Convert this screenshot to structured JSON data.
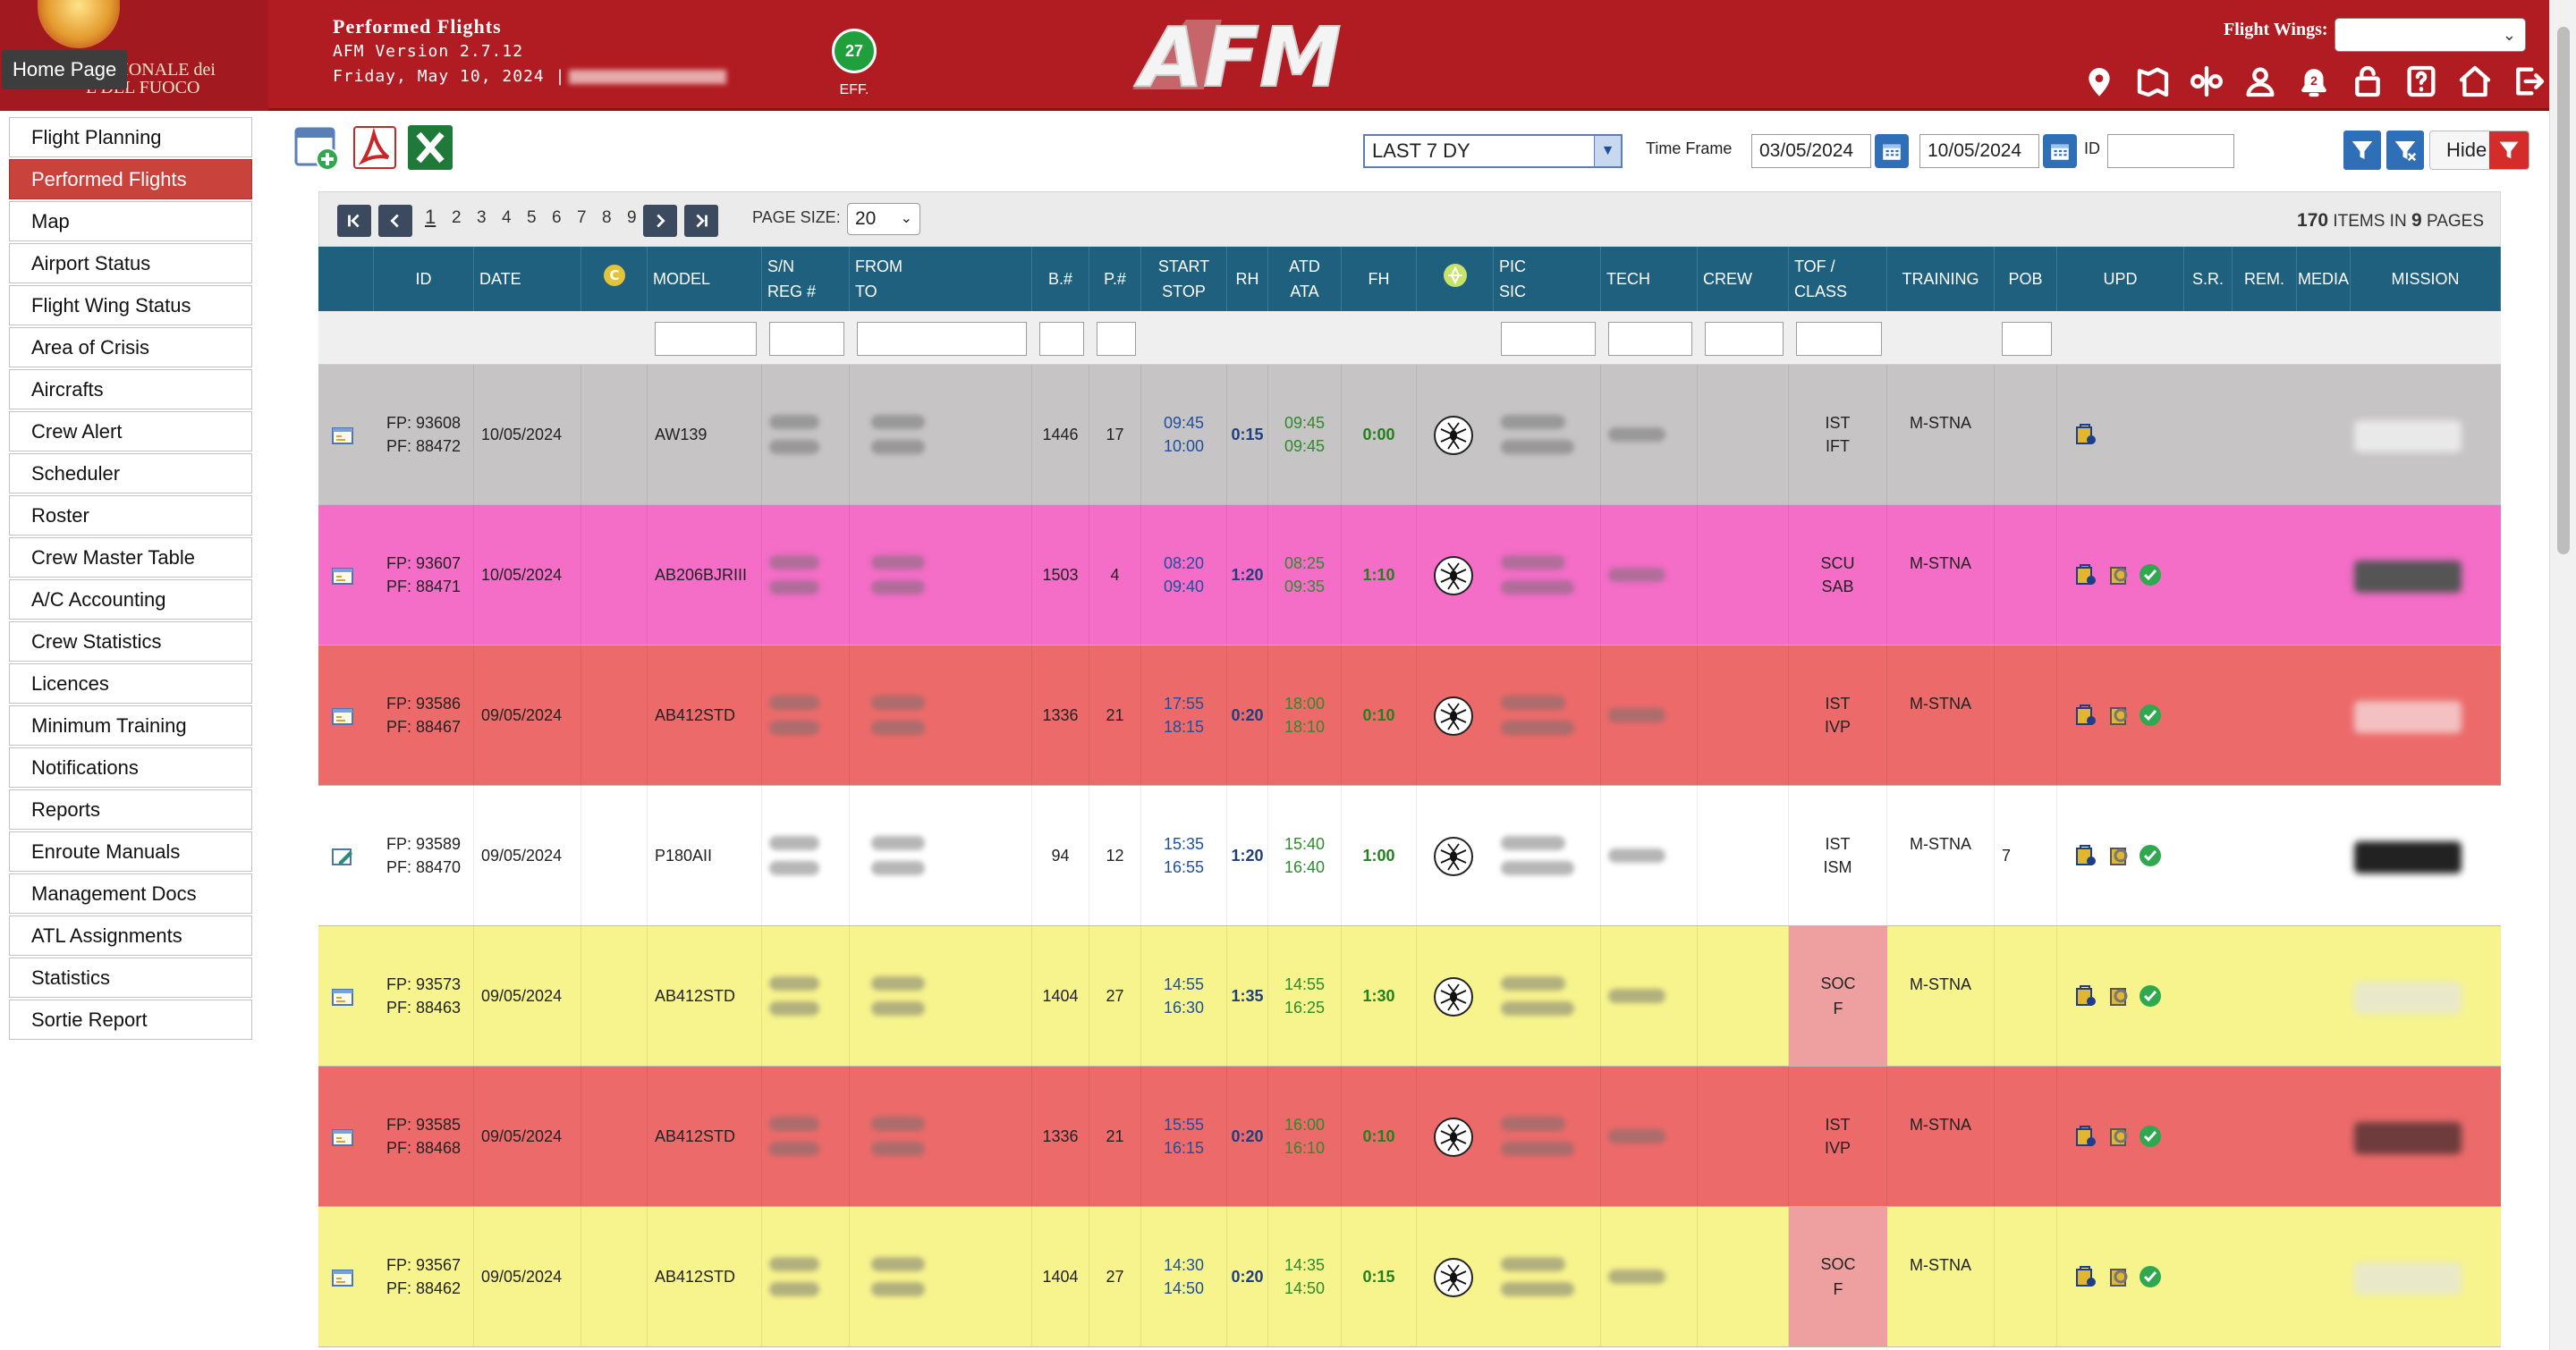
{
  "header": {
    "title": "Performed Flights",
    "version": "AFM Version 2.7.12",
    "date": "Friday, May 10, 2024 |",
    "logo_text": "NAZIONALE dei\nL DEL FUOCO",
    "home_tooltip": "Home Page",
    "eff_count": "27",
    "eff_label": "EFF.",
    "flight_wings_label": "Flight Wings:",
    "flight_wings_value": "",
    "notifications_count": "2",
    "colors": {
      "brand": "#b01c22",
      "active_nav": "#c9423c",
      "table_header": "#1f607f"
    }
  },
  "header_icons": [
    "location-icon",
    "map-icon",
    "routes-icon",
    "user-icon",
    "bell-icon",
    "lock-icon",
    "help-icon",
    "home-icon",
    "logout-icon"
  ],
  "sidebar": {
    "items": [
      {
        "label": "Flight Planning",
        "active": false
      },
      {
        "label": "Performed Flights",
        "active": true
      },
      {
        "label": "Map",
        "active": false
      },
      {
        "label": "Airport Status",
        "active": false
      },
      {
        "label": "Flight Wing Status",
        "active": false
      },
      {
        "label": "Area of Crisis",
        "active": false
      },
      {
        "label": "Aircrafts",
        "active": false
      },
      {
        "label": "Crew Alert",
        "active": false
      },
      {
        "label": "Scheduler",
        "active": false
      },
      {
        "label": "Roster",
        "active": false
      },
      {
        "label": "Crew Master Table",
        "active": false
      },
      {
        "label": "A/C Accounting",
        "active": false
      },
      {
        "label": "Crew Statistics",
        "active": false
      },
      {
        "label": "Licences",
        "active": false
      },
      {
        "label": "Minimum Training",
        "active": false
      },
      {
        "label": "Notifications",
        "active": false
      },
      {
        "label": "Reports",
        "active": false
      },
      {
        "label": "Enroute Manuals",
        "active": false
      },
      {
        "label": "Management Docs",
        "active": false
      },
      {
        "label": "ATL Assignments",
        "active": false
      },
      {
        "label": "Statistics",
        "active": false
      },
      {
        "label": "Sortie Report",
        "active": false
      }
    ]
  },
  "toolbar": {
    "period": "LAST 7 DY",
    "time_frame_label": "Time Frame",
    "date_from": "03/05/2024",
    "date_to": "10/05/2024",
    "id_label": "ID",
    "id_value": "",
    "hide_label": "Hide"
  },
  "pager": {
    "pages": [
      "1",
      "2",
      "3",
      "4",
      "5",
      "6",
      "7",
      "8",
      "9"
    ],
    "current": "1",
    "page_size_label": "PAGE SIZE:",
    "page_size": "20",
    "total_items": "170",
    "items_in_label": "ITEMS IN",
    "total_pages": "9",
    "pages_label": "PAGES"
  },
  "columns": [
    {
      "key": "icon",
      "l1": "",
      "l2": ""
    },
    {
      "key": "id",
      "l1": "ID",
      "l2": ""
    },
    {
      "key": "date",
      "l1": "DATE",
      "l2": ""
    },
    {
      "key": "c",
      "l1": "",
      "l2": ""
    },
    {
      "key": "model",
      "l1": "MODEL",
      "l2": ""
    },
    {
      "key": "sn",
      "l1": "S/N",
      "l2": "REG #"
    },
    {
      "key": "from",
      "l1": "FROM",
      "l2": "TO"
    },
    {
      "key": "b",
      "l1": "B.#",
      "l2": ""
    },
    {
      "key": "p",
      "l1": "P.#",
      "l2": ""
    },
    {
      "key": "start",
      "l1": "START",
      "l2": "STOP"
    },
    {
      "key": "rh",
      "l1": "RH",
      "l2": ""
    },
    {
      "key": "atd",
      "l1": "ATD",
      "l2": "ATA"
    },
    {
      "key": "fh",
      "l1": "FH",
      "l2": ""
    },
    {
      "key": "op",
      "l1": "",
      "l2": ""
    },
    {
      "key": "pic",
      "l1": "PIC",
      "l2": "SIC"
    },
    {
      "key": "tech",
      "l1": "TECH",
      "l2": ""
    },
    {
      "key": "crew",
      "l1": "CREW",
      "l2": ""
    },
    {
      "key": "tof",
      "l1": "TOF /",
      "l2": "CLASS"
    },
    {
      "key": "training",
      "l1": "TRAINING",
      "l2": ""
    },
    {
      "key": "pob",
      "l1": "POB",
      "l2": ""
    },
    {
      "key": "upd",
      "l1": "UPD",
      "l2": ""
    },
    {
      "key": "sr",
      "l1": "S.R.",
      "l2": ""
    },
    {
      "key": "rem",
      "l1": "REM.",
      "l2": ""
    },
    {
      "key": "media",
      "l1": "MEDIA",
      "l2": ""
    },
    {
      "key": "mission",
      "l1": "MISSION",
      "l2": ""
    }
  ],
  "rows": [
    {
      "bg": "#c6c4c4",
      "fp": "FP: 93608",
      "pf": "PF: 88472",
      "date": "10/05/2024",
      "model": "AW139",
      "b": "1446",
      "p": "17",
      "start": "09:45",
      "stop": "10:00",
      "rh": "0:15",
      "atd": "09:45",
      "ata": "09:45",
      "fh": "0:00",
      "tof": "IST",
      "cls": "IFT",
      "training": "M-STNA",
      "pob": "",
      "upd_count": 1,
      "cls_bg": "",
      "icon": "doc",
      "media": "#e9e9e9"
    },
    {
      "bg": "#f46dc7",
      "fp": "FP: 93607",
      "pf": "PF: 88471",
      "date": "10/05/2024",
      "model": "AB206BJRIII",
      "b": "1503",
      "p": "4",
      "start": "08:20",
      "stop": "09:40",
      "rh": "1:20",
      "atd": "08:25",
      "ata": "09:35",
      "fh": "1:10",
      "tof": "SCU",
      "cls": "SAB",
      "training": "M-STNA",
      "pob": "",
      "upd_count": 3,
      "cls_bg": "",
      "icon": "doc",
      "media": "#555"
    },
    {
      "bg": "#ec6a6a",
      "fp": "FP: 93586",
      "pf": "PF: 88467",
      "date": "09/05/2024",
      "model": "AB412STD",
      "b": "1336",
      "p": "21",
      "start": "17:55",
      "stop": "18:15",
      "rh": "0:20",
      "atd": "18:00",
      "ata": "18:10",
      "fh": "0:10",
      "tof": "IST",
      "cls": "IVP",
      "training": "M-STNA",
      "pob": "",
      "upd_count": 3,
      "cls_bg": "",
      "icon": "doc",
      "media": "#f3c1c1"
    },
    {
      "bg": "#ffffff",
      "fp": "FP: 93589",
      "pf": "PF: 88470",
      "date": "09/05/2024",
      "model": "P180AII",
      "b": "94",
      "p": "12",
      "start": "15:35",
      "stop": "16:55",
      "rh": "1:20",
      "atd": "15:40",
      "ata": "16:40",
      "fh": "1:00",
      "tof": "IST",
      "cls": "ISM",
      "training": "M-STNA",
      "pob": "7",
      "upd_count": 3,
      "cls_bg": "",
      "icon": "edit",
      "media": "#222"
    },
    {
      "bg": "#f7f48e",
      "fp": "FP: 93573",
      "pf": "PF: 88463",
      "date": "09/05/2024",
      "model": "AB412STD",
      "b": "1404",
      "p": "27",
      "start": "14:55",
      "stop": "16:30",
      "rh": "1:35",
      "atd": "14:55",
      "ata": "16:25",
      "fh": "1:30",
      "tof": "SOC",
      "cls": "F",
      "training": "M-STNA",
      "pob": "",
      "upd_count": 3,
      "cls_bg": "#eea0a0",
      "icon": "doc",
      "media": "#e9e9c9"
    },
    {
      "bg": "#ec6a6a",
      "fp": "FP: 93585",
      "pf": "PF: 88468",
      "date": "09/05/2024",
      "model": "AB412STD",
      "b": "1336",
      "p": "21",
      "start": "15:55",
      "stop": "16:15",
      "rh": "0:20",
      "atd": "16:00",
      "ata": "16:10",
      "fh": "0:10",
      "tof": "IST",
      "cls": "IVP",
      "training": "M-STNA",
      "pob": "",
      "upd_count": 3,
      "cls_bg": "",
      "icon": "doc",
      "media": "#6e3c3c"
    },
    {
      "bg": "#f7f48e",
      "fp": "FP: 93567",
      "pf": "PF: 88462",
      "date": "09/05/2024",
      "model": "AB412STD",
      "b": "1404",
      "p": "27",
      "start": "14:30",
      "stop": "14:50",
      "rh": "0:20",
      "atd": "14:35",
      "ata": "14:50",
      "fh": "0:15",
      "tof": "SOC",
      "cls": "F",
      "training": "M-STNA",
      "pob": "",
      "upd_count": 3,
      "cls_bg": "#eea0a0",
      "icon": "doc",
      "media": "#e9e9c9"
    }
  ]
}
